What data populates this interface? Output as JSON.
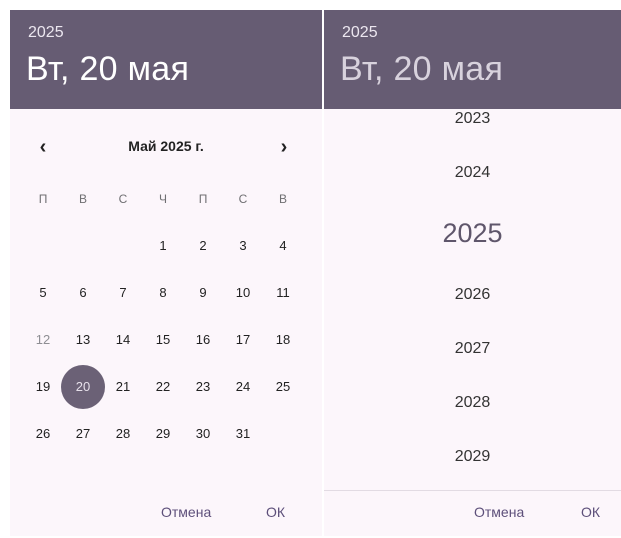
{
  "calendar_dialog": {
    "header": {
      "year": "2025",
      "date": "Вт, 20 мая"
    },
    "month_title": "Май 2025 г.",
    "prev_icon": "‹",
    "next_icon": "›",
    "weekdays": [
      "П",
      "В",
      "С",
      "Ч",
      "П",
      "С",
      "В"
    ],
    "days": {
      "d1": "1",
      "d2": "2",
      "d3": "3",
      "d4": "4",
      "d5": "5",
      "d6": "6",
      "d7": "7",
      "d8": "8",
      "d9": "9",
      "d10": "10",
      "d11": "11",
      "d12": "12",
      "d13": "13",
      "d14": "14",
      "d15": "15",
      "d16": "16",
      "d17": "17",
      "d18": "18",
      "d19": "19",
      "d20": "20",
      "d21": "21",
      "d22": "22",
      "d23": "23",
      "d24": "24",
      "d25": "25",
      "d26": "26",
      "d27": "27",
      "d28": "28",
      "d29": "29",
      "d30": "30",
      "d31": "31"
    },
    "selected_day": "20",
    "cancel_label": "Отмена",
    "ok_label": "ОК"
  },
  "year_dialog": {
    "header": {
      "year": "2025",
      "date": "Вт, 20 мая"
    },
    "years": {
      "y2023": "2023",
      "y2024": "2024",
      "y2025": "2025",
      "y2026": "2026",
      "y2027": "2027",
      "y2028": "2028",
      "y2029": "2029"
    },
    "selected_year": "2025",
    "cancel_label": "Отмена",
    "ok_label": "ОК"
  },
  "colors": {
    "header_bg": "#665c73",
    "dialog_bg": "#fcf6fb",
    "accent_text": "#5d4f7a",
    "selection_circle": "#6b6176"
  }
}
